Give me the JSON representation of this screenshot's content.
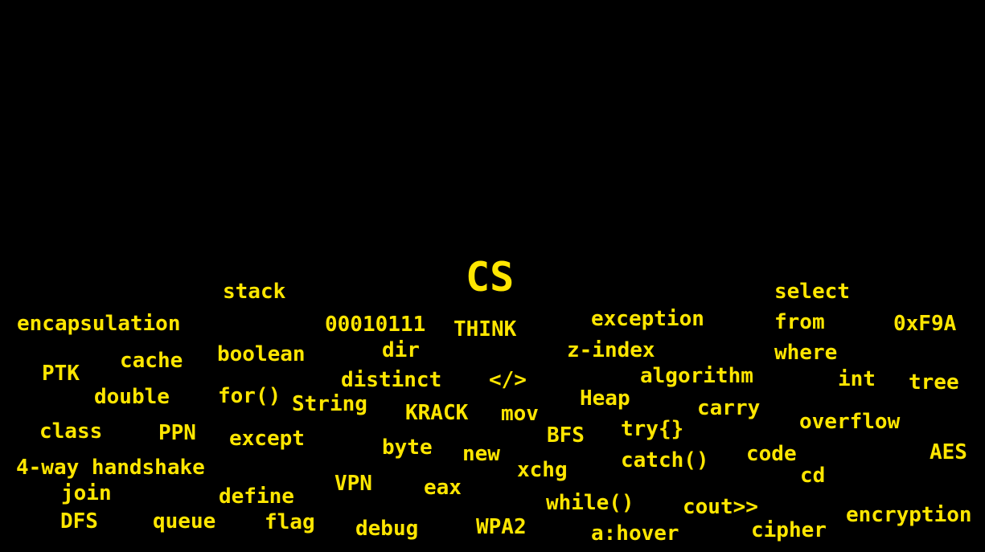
{
  "colors": {
    "background": "#000000",
    "text": "#FFE600"
  },
  "title": "CS",
  "words": [
    "stack",
    "select",
    "encapsulation",
    "00010111",
    "THINK",
    "exception",
    "from",
    "0xF9A",
    "dir",
    "z-index",
    "where",
    "PTK",
    "cache",
    "boolean",
    "distinct",
    "</>",
    "algorithm",
    "int",
    "tree",
    "double",
    "for()",
    "String",
    "KRACK",
    "mov",
    "Heap",
    "carry",
    "overflow",
    "class",
    "PPN",
    "except",
    "byte",
    "BFS",
    "try{}",
    "new",
    "catch()",
    "code",
    "AES",
    "4-way handshake",
    "xchg",
    "cd",
    "join",
    "define",
    "VPN",
    "eax",
    "while()",
    "cout>>",
    "DFS",
    "queue",
    "flag",
    "debug",
    "WPA2",
    "a:hover",
    "cipher",
    "encryption"
  ]
}
